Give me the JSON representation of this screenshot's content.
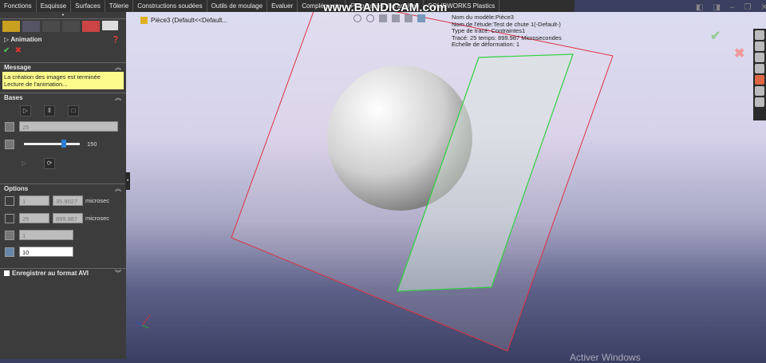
{
  "tabs": [
    "Fonctions",
    "Esquisse",
    "Surfaces",
    "Tôlerie",
    "Constructions soudées",
    "Outils de moulage",
    "Evaluer",
    "Compléments",
    "Préparation de l'analyse",
    "SOLIDWORKS Plastics"
  ],
  "watermark": "www.BANDICAM.com",
  "tree": {
    "item": "Pièce3  (Default<<Default..."
  },
  "panel": {
    "title": "Animation",
    "message_header": "Message",
    "message": [
      "La création des images est terminée",
      "Lecture de l'animation..."
    ],
    "bases_header": "Bases",
    "frames_value": "25",
    "speed_value": "150",
    "speed_fraction": 0.7,
    "options_header": "Options",
    "start_step": "1",
    "start_time": "35.9027",
    "start_unit": "microsec",
    "end_step": "25",
    "end_time": "899.987",
    "end_unit": "microsec",
    "step_increment": "1",
    "frames_count": "10",
    "save_avi_label": "Enregistrer au format AVI"
  },
  "info": [
    "Nom du modèle:Pièce3",
    "Nom de l'étude:Test de chute 1(-Default-)",
    "Type de tracé:  Contraintes1",
    "Tracé: 25   temps: 899.987 Microsecondes",
    "Echelle de déformation: 1"
  ],
  "activate_windows": "Activer Windows",
  "colors": {
    "accent_yellow": "#fdfb8c",
    "plane_red": "#e03040",
    "plane_green": "#30d040"
  }
}
